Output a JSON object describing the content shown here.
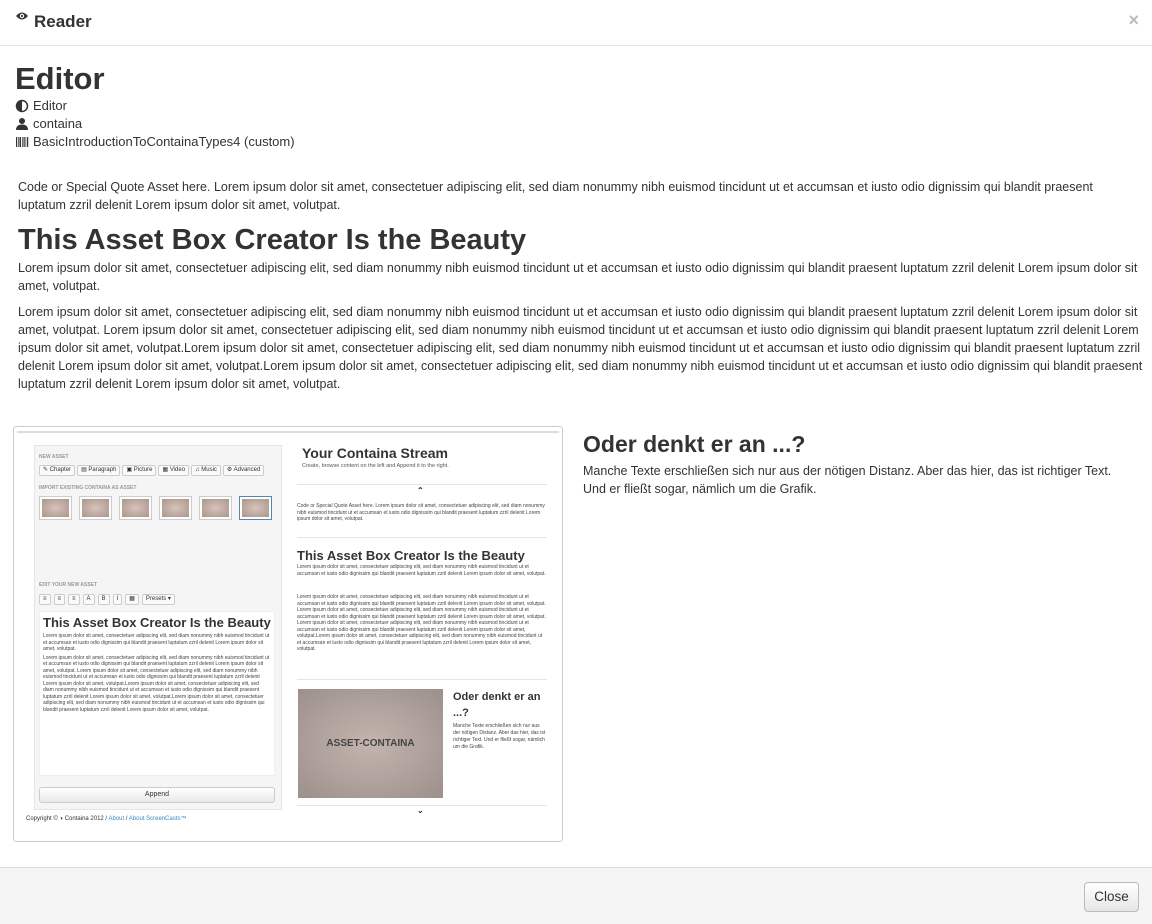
{
  "header": {
    "title": "Reader",
    "close_glyph": "×",
    "icon": "eye-icon"
  },
  "asset": {
    "title": "Editor",
    "meta": [
      {
        "icon": "contrast-icon",
        "text": "Editor"
      },
      {
        "icon": "user-icon",
        "text": "containa"
      },
      {
        "icon": "barcode-icon",
        "text": "BasicIntroductionToContainaTypes4 (custom)"
      }
    ],
    "intro": "Code or Special Quote Asset here. Lorem ipsum dolor sit amet, consectetuer adipiscing elit, sed diam nonummy nibh euismod tincidunt ut et accumsan et iusto odio dignissim qui blandit praesent luptatum zzril delenit Lorem ipsum dolor sit amet, volutpat.",
    "heading": "This Asset Box Creator Is the Beauty",
    "paragraph1": "Lorem ipsum dolor sit amet, consectetuer adipiscing elit, sed diam nonummy nibh euismod tincidunt ut et accumsan et iusto odio dignissim qui blandit praesent luptatum zzril delenit Lorem ipsum dolor sit amet, volutpat.",
    "paragraph2": "Lorem ipsum dolor sit amet, consectetuer adipiscing elit, sed diam nonummy nibh euismod tincidunt ut et accumsan et iusto odio dignissim qui blandit praesent luptatum zzril delenit Lorem ipsum dolor sit amet, volutpat. Lorem ipsum dolor sit amet, consectetuer adipiscing elit, sed diam nonummy nibh euismod tincidunt ut et accumsan et iusto odio dignissim qui blandit praesent luptatum zzril delenit Lorem ipsum dolor sit amet, volutpat.Lorem ipsum dolor sit amet, consectetuer adipiscing elit, sed diam nonummy nibh euismod tincidunt ut et accumsan et iusto odio dignissim qui blandit praesent luptatum zzril delenit Lorem ipsum dolor sit amet, volutpat.Lorem ipsum dolor sit amet, consectetuer adipiscing elit, sed diam nonummy nibh euismod tincidunt ut et accumsan et iusto odio dignissim qui blandit praesent luptatum zzril delenit Lorem ipsum dolor sit amet, volutpat.",
    "side_heading": "Oder denkt er an ...?",
    "side_text": "Manche Texte erschließen sich nur aus der nötigen Distanz. Aber das hier, das ist richtiger Text. Und er fließt sogar, nämlich um die Grafik."
  },
  "screenshot": {
    "new_asset_label": "NEW ASSET",
    "buttons": [
      "Chapter",
      "Paragraph",
      "Picture",
      "Video",
      "Music",
      "Advanced"
    ],
    "import_label": "IMPORT EXISTING CONTAINA AS ASSET",
    "edit_label": "EDIT YOUR NEW ASSET",
    "toolbar": [
      "≡",
      "≡",
      "≡",
      "A",
      "B",
      "I",
      "▦",
      "Presets ▾"
    ],
    "editor_heading": "This Asset Box Creator Is the Beauty",
    "editor_p1": "Lorem ipsum dolor sit amet, consectetuer adipiscing elit, sed diam nonummy nibh euismod tincidunt ut et accumsan et iusto odio dignissim qui blandit praesent luptatum zzril delenit Lorem ipsum dolor sit amet, volutpat.",
    "editor_p2": "Lorem ipsum dolor sit amet, consectetuer adipiscing elit, sed diam nonummy nibh euismod tincidunt ut et accumsan et iusto odio dignissim qui blandit praesent luptatum zzril delenit Lorem ipsum dolor sit amet, volutpat. Lorem ipsum dolor sit amet, consectetuer adipiscing elit, sed diam nonummy nibh euismod tincidunt ut et accumsan et iusto odio dignissim qui blandit praesent luptatum zzril delenit Lorem ipsum dolor sit amet, volutpat.Lorem ipsum dolor sit amet, consectetuer adipiscing elit, sed diam nonummy nibh euismod tincidunt ut et accumsan et iusto odio dignissim qui blandit praesent luptatum zzril delenit Lorem ipsum dolor sit amet, volutpat.Lorem ipsum dolor sit amet, consectetuer adipiscing elit, sed diam nonummy nibh euismod tincidunt ut et accumsan et iusto odio dignissim qui blandit praesent luptatum zzril delenit Lorem ipsum dolor sit amet, volutpat.",
    "append": "Append",
    "copyright": "Copyright © ◑ Containa 2012 / ",
    "link_about": "About",
    "link_sep": " / ",
    "link_screencasts": "About ScreenCasts™",
    "stream_title": "Your Containa Stream",
    "stream_sub": "Create, browse content on the left and Append it to the right.",
    "stream_intro": "Code or Special Quote Asset here. Lorem ipsum dolor sit amet, consectetuer adipiscing elit, sed diam nonummy nibh euismod tincidunt ut et accumsan et iusto odio dignissim qui blandit praesent luptatum zzril delenit Lorem ipsum dolor sit amet, volutpat.",
    "stream_heading": "This Asset Box Creator Is the Beauty",
    "stream_p1": "Lorem ipsum dolor sit amet, consectetuer adipiscing elit, sed diam nonummy nibh euismod tincidunt ut et accumsan et iusto odio dignissim qui blandit praesent luptatum zzril delenit Lorem ipsum dolor sit amet, volutpat.",
    "stream_p2": "Lorem ipsum dolor sit amet, consectetuer adipiscing elit, sed diam nonummy nibh euismod tincidunt ut et accumsan et iusto odio dignissim qui blandit praesent luptatum zzril delenit Lorem ipsum dolor sit amet, volutpat. Lorem ipsum dolor sit amet, consectetuer adipiscing elit, sed diam nonummy nibh euismod tincidunt ut et accumsan et iusto odio dignissim qui blandit praesent luptatum zzril delenit Lorem ipsum dolor sit amet, volutpat. Lorem ipsum dolor sit amet, consectetuer adipiscing elit, sed diam nonummy nibh euismod tincidunt ut et accumsan et iusto odio dignissim qui blandit praesent luptatum zzril delenit Lorem ipsum dolor sit amet, volutpat.Lorem ipsum dolor sit amet, consectetuer adipiscing elit, sed diam nonummy nibh euismod tincidunt ut et accumsan et iusto odio dignissim qui blandit praesent luptatum zzril delenit Lorem ipsum dolor sit amet, volutpat.",
    "asset_label": "ASSET-CONTAINA",
    "oder_heading": "Oder denkt er an ...?",
    "oder_text": "Manche Texte erschließen sich nur aus der nötigen Distanz. Aber das hier, das ist richtiger Text. Und er fließt sogar, nämlich um die Grafik.",
    "caret_up": "⌃",
    "caret_down": "⌄"
  },
  "footer": {
    "close_label": "Close"
  }
}
